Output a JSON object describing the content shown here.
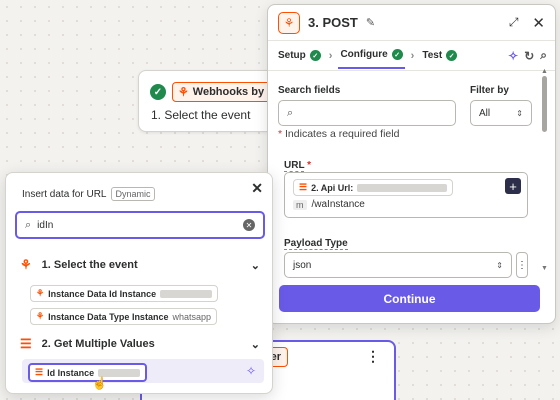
{
  "step_card": {
    "app_name": "Webhooks by Zap",
    "title": "1. Select the event"
  },
  "bottom_card": {
    "chip_text": "er"
  },
  "panel": {
    "title": "3. POST",
    "tabs": [
      {
        "label": "Setup"
      },
      {
        "label": "Configure"
      },
      {
        "label": "Test"
      }
    ],
    "search_label": "Search fields",
    "filter_label": "Filter by",
    "filter_value": "All",
    "required_note": "Indicates a required field",
    "url_label": "URL",
    "url_chip_label": "2. Api Url:",
    "url_suffix": "/waInstance",
    "url_prefix_icon": "m",
    "payload_label": "Payload Type",
    "payload_value": "json",
    "continue_label": "Continue"
  },
  "dropdown": {
    "title": "Insert data for URL",
    "badge": "Dynamic",
    "search_value": "idIn",
    "group1": {
      "title": "1.  Select the event",
      "items": [
        {
          "label": "Instance Data Id Instance",
          "value": ""
        },
        {
          "label": "Instance Data Type Instance",
          "value": "whatsapp"
        }
      ]
    },
    "group2": {
      "title": "2.  Get Multiple Values",
      "items": [
        {
          "label": "Id Instance",
          "value": ""
        }
      ]
    }
  },
  "colors": {
    "accent": "#695be8",
    "brand": "#ff4f00",
    "success": "#1f8a4c"
  }
}
